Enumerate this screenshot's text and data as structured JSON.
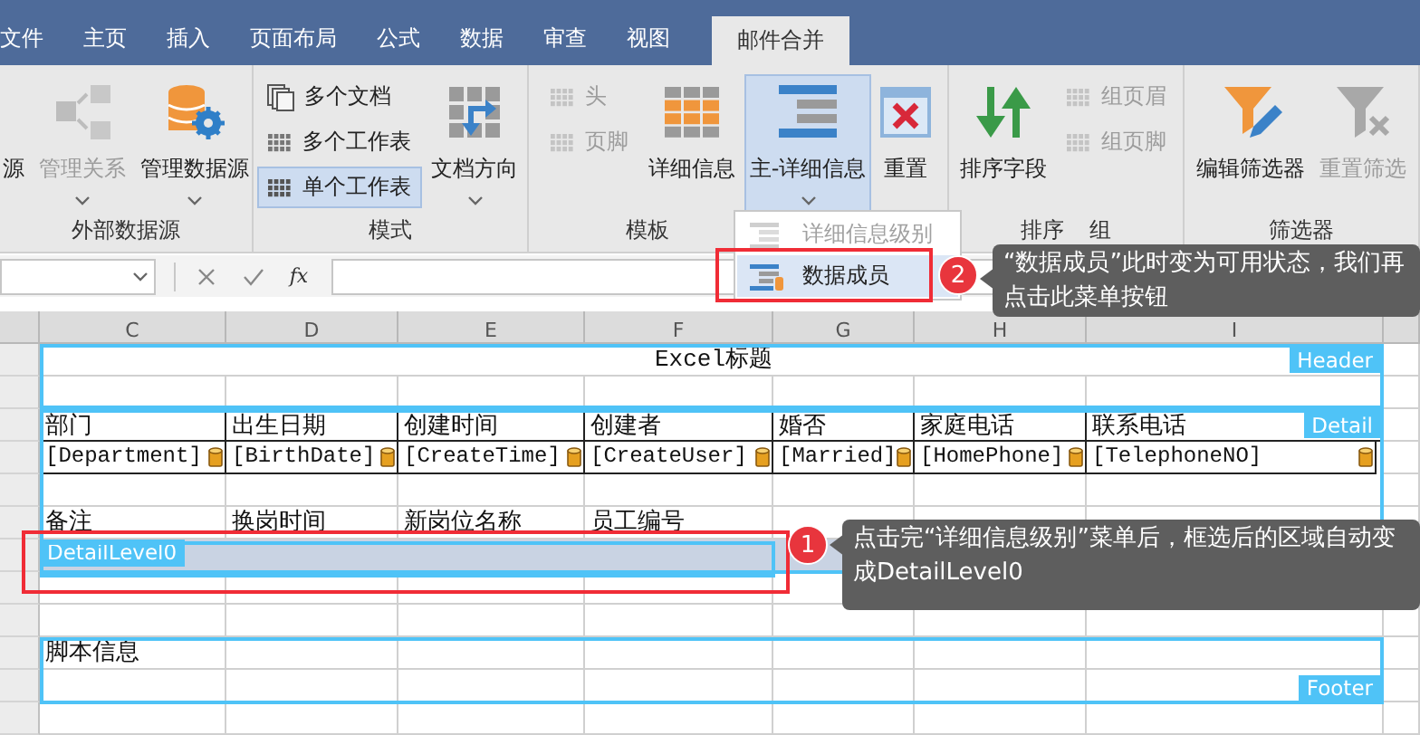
{
  "menu_tabs": [
    {
      "label": "文件",
      "selected": false
    },
    {
      "label": "主页",
      "selected": false
    },
    {
      "label": "插入",
      "selected": false
    },
    {
      "label": "页面布局",
      "selected": false
    },
    {
      "label": "公式",
      "selected": false
    },
    {
      "label": "数据",
      "selected": false
    },
    {
      "label": "审查",
      "selected": false
    },
    {
      "label": "视图",
      "selected": false
    },
    {
      "label": "邮件合并",
      "selected": true
    }
  ],
  "ribbon": {
    "groups": [
      {
        "labels": [
          "外部数据源"
        ],
        "buttons": [
          {
            "kind": "large",
            "label": "源",
            "disabled": false,
            "dropdown": false,
            "selected": false
          },
          {
            "kind": "large",
            "label": "管理关系",
            "disabled": true,
            "dropdown": true,
            "selected": false
          },
          {
            "kind": "large",
            "label": "管理数据源",
            "disabled": false,
            "dropdown": true,
            "selected": false
          }
        ]
      },
      {
        "labels": [
          "模式"
        ],
        "buttons": [
          {
            "kind": "small",
            "label": "多个文档",
            "disabled": false,
            "dropdown": false,
            "selected": false
          },
          {
            "kind": "small",
            "label": "多个工作表",
            "disabled": false,
            "dropdown": false,
            "selected": false
          },
          {
            "kind": "small",
            "label": "单个工作表",
            "disabled": false,
            "dropdown": false,
            "selected": true
          },
          {
            "kind": "large",
            "label": "文档方向",
            "disabled": false,
            "dropdown": true,
            "selected": false
          }
        ]
      },
      {
        "labels": [
          "模板"
        ],
        "buttons": [
          {
            "kind": "small",
            "label": "头",
            "disabled": true,
            "dropdown": false,
            "selected": false
          },
          {
            "kind": "small",
            "label": "页脚",
            "disabled": true,
            "dropdown": false,
            "selected": false
          },
          {
            "kind": "large",
            "label": "详细信息",
            "disabled": false,
            "dropdown": false,
            "selected": false
          },
          {
            "kind": "large",
            "label": "主-详细信息",
            "disabled": false,
            "dropdown": true,
            "selected": true
          },
          {
            "kind": "large",
            "label": "重置",
            "disabled": false,
            "dropdown": false,
            "selected": false
          }
        ]
      },
      {
        "labels": [
          "排序",
          "组"
        ],
        "buttons": [
          {
            "kind": "large",
            "label": "排序字段",
            "disabled": false,
            "dropdown": false,
            "selected": false
          },
          {
            "kind": "small",
            "label": "组页眉",
            "disabled": true,
            "dropdown": false,
            "selected": false
          },
          {
            "kind": "small",
            "label": "组页脚",
            "disabled": true,
            "dropdown": false,
            "selected": false
          }
        ]
      },
      {
        "labels": [
          "筛选器"
        ],
        "buttons": [
          {
            "kind": "large",
            "label": "编辑筛选器",
            "disabled": false,
            "dropdown": false,
            "selected": false
          },
          {
            "kind": "large",
            "label": "重置筛选",
            "disabled": true,
            "dropdown": false,
            "selected": false
          }
        ]
      }
    ]
  },
  "dropdown_menu": [
    {
      "label": "详细信息级别",
      "disabled": true,
      "selected": false
    },
    {
      "label": "数据成员",
      "disabled": false,
      "selected": true
    }
  ],
  "formula_bar": {
    "function_label": "fx"
  },
  "sheet": {
    "columns": [
      "C",
      "D",
      "E",
      "F",
      "G",
      "H",
      "I"
    ],
    "rows": [
      {
        "kind": "title",
        "text": "Excel标题"
      },
      {
        "kind": "blank"
      },
      {
        "kind": "labels",
        "cells": [
          "部门",
          "出生日期",
          "创建时间",
          "创建者",
          "婚否",
          "家庭电话",
          "联系电话"
        ]
      },
      {
        "kind": "fields",
        "cells": [
          "[Department]",
          "[BirthDate]",
          "[CreateTime]",
          "[CreateUser]",
          "[Married]",
          "[HomePhone]",
          "[TelephoneNO]"
        ]
      },
      {
        "kind": "blank"
      },
      {
        "kind": "plain",
        "cells": [
          "备注",
          "换岗时间",
          "新岗位名称",
          "员工编号"
        ]
      },
      {
        "kind": "selected_band",
        "text": "DetailLevel0"
      },
      {
        "kind": "blank"
      },
      {
        "kind": "blank"
      },
      {
        "kind": "plain",
        "cells": [
          "脚本信息"
        ]
      },
      {
        "kind": "blank"
      },
      {
        "kind": "blank"
      }
    ],
    "bands": [
      "Header",
      "Detail",
      "Footer"
    ]
  },
  "callouts": [
    {
      "number": "2",
      "text": "“数据成员”此时变为可用状态，我们再点击此菜单按钮"
    },
    {
      "number": "1",
      "text": "点击完“详细信息级别”菜单后，框选后的区域自动变成DetailLevel0"
    }
  ]
}
